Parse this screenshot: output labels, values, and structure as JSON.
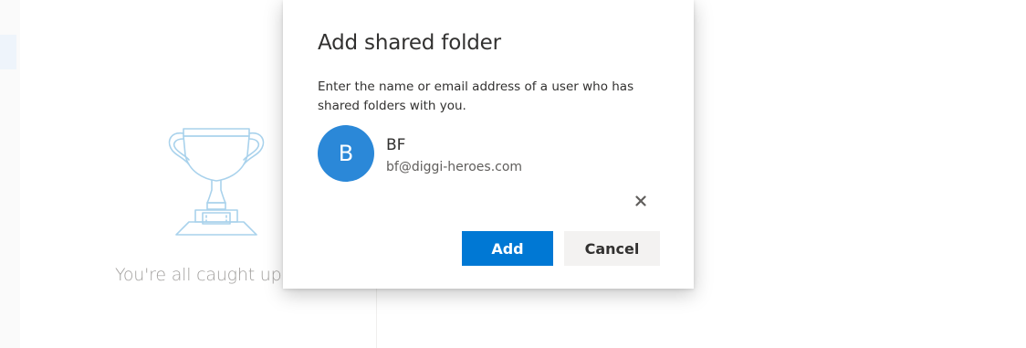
{
  "background": {
    "empty_state_text": "You're all caught up."
  },
  "dialog": {
    "title": "Add shared folder",
    "description": "Enter the name or email address of a user who has shared folders with you.",
    "persona": {
      "initial": "B",
      "name": "BF",
      "email": "bf@diggi-heroes.com",
      "avatar_color": "#2b88d8"
    },
    "remove_icon": "close-icon",
    "add_label": "Add",
    "cancel_label": "Cancel",
    "accent": "#0078d4"
  }
}
